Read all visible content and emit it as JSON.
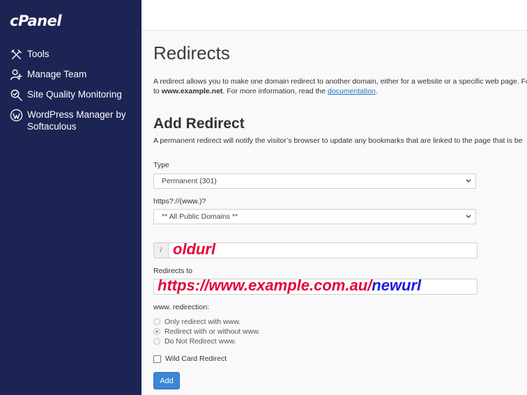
{
  "sidebar": {
    "logo": "cPanel",
    "items": [
      {
        "icon": "tools-icon",
        "label": "Tools"
      },
      {
        "icon": "manage-team-icon",
        "label": "Manage Team"
      },
      {
        "icon": "site-quality-icon",
        "label": "Site Quality Monitoring"
      },
      {
        "icon": "wordpress-icon",
        "label_line1": "WordPress Manager by",
        "label_line2": "Softaculous"
      }
    ]
  },
  "main": {
    "title": "Redirects",
    "intro": {
      "line1": "A redirect allows you to make one domain redirect to another domain, either for a website or a specific web page. For e",
      "line2_prefix": "to ",
      "line2_bold": "www.example.net",
      "line2_mid": ". For more information, read the ",
      "link": "documentation",
      "line2_suffix": "."
    },
    "add_title": "Add Redirect",
    "add_desc": "A permanent redirect will notify the visitor’s browser to update any bookmarks that are linked to the page that is be",
    "type_label": "Type",
    "type_value": "Permanent (301)",
    "domain_label": "https?://(www.)?",
    "domain_value": "** All Public Domains **",
    "path_prefix": "/",
    "path_value": "oldurl",
    "redirects_to_label": "Redirects to",
    "redirects_to_red": "https://www.example.com.au/",
    "redirects_to_blue": "newurl",
    "www_label": "www. redirection:",
    "www_options": [
      "Only redirect with www.",
      "Redirect with or without www.",
      "Do Not Redirect www."
    ],
    "wildcard_label": "Wild Card Redirect",
    "add_button": "Add"
  },
  "colors": {
    "sidebar_bg": "#1c2453",
    "annotation_red": "#e4003b",
    "annotation_blue": "#1a1ae0",
    "button_blue": "#3c86d6",
    "link_blue": "#1a73c8"
  }
}
